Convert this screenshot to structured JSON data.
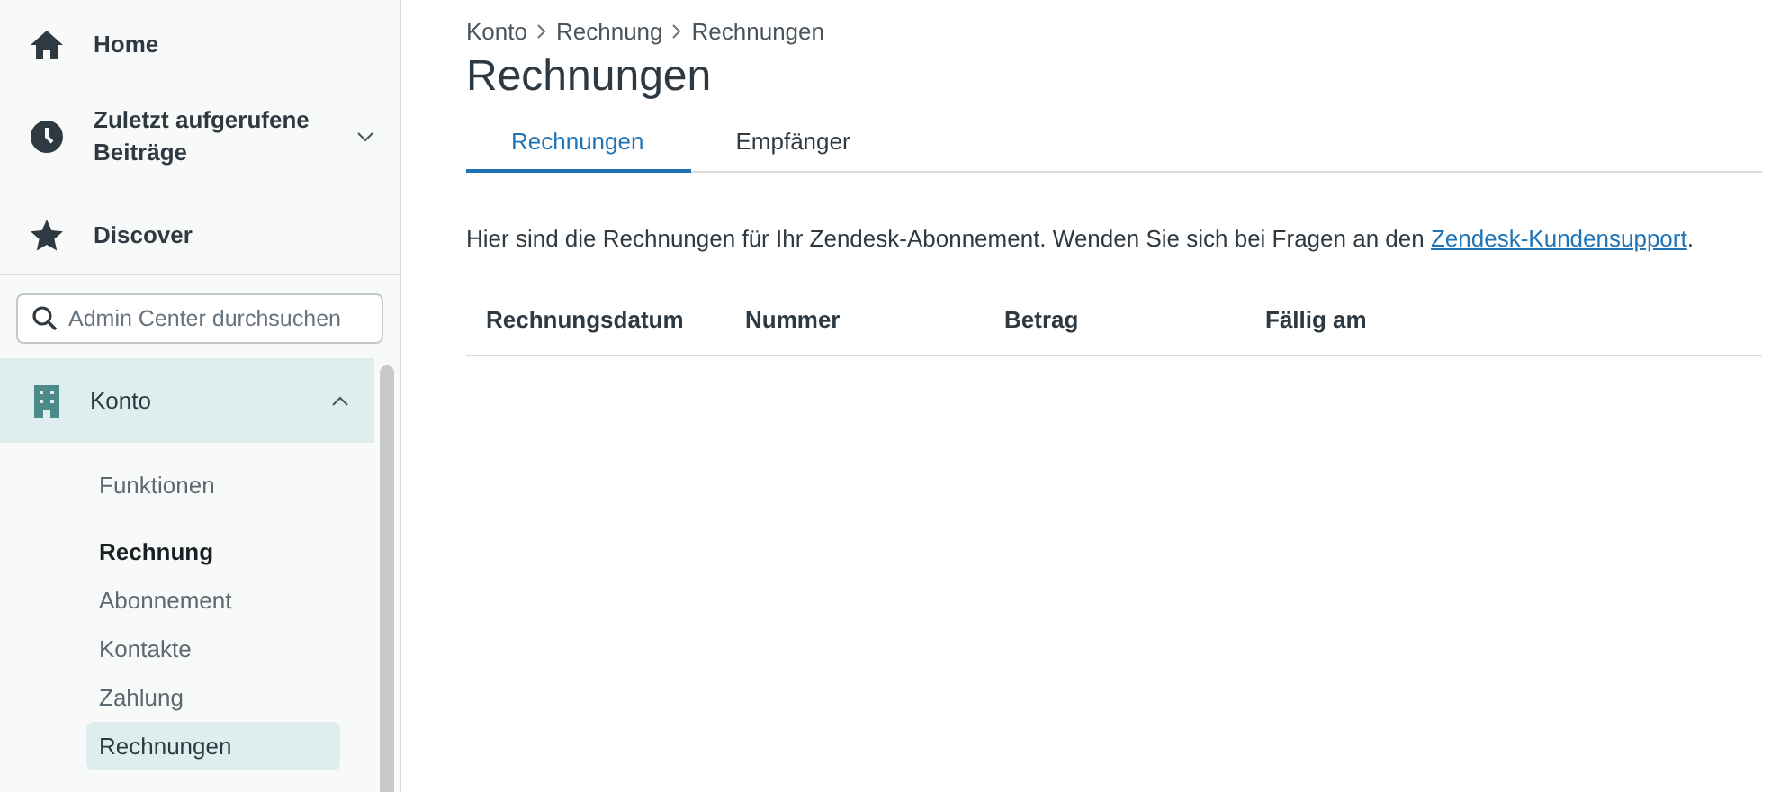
{
  "sidebar": {
    "nav": [
      {
        "label": "Home",
        "kind": "home"
      },
      {
        "label": "Zuletzt aufgerufene Beiträge",
        "kind": "clock",
        "expanded": false
      },
      {
        "label": "Discover",
        "kind": "star"
      }
    ],
    "search": {
      "placeholder": "Admin Center durchsuchen"
    },
    "section": {
      "label": "Konto",
      "expanded": true,
      "items": [
        {
          "label": "Funktionen",
          "kind": "link",
          "selected": false
        },
        {
          "label": "Rechnung",
          "kind": "heading",
          "selected": false
        },
        {
          "label": "Abonnement",
          "kind": "link",
          "selected": false
        },
        {
          "label": "Kontakte",
          "kind": "link",
          "selected": false
        },
        {
          "label": "Zahlung",
          "kind": "link",
          "selected": false
        },
        {
          "label": "Rechnungen",
          "kind": "link",
          "selected": true
        }
      ]
    }
  },
  "breadcrumb": [
    "Konto",
    "Rechnung",
    "Rechnungen"
  ],
  "title": "Rechnungen",
  "tabs": [
    {
      "label": "Rechnungen",
      "selected": true
    },
    {
      "label": "Empfänger",
      "selected": false
    }
  ],
  "description": {
    "text": "Hier sind die Rechnungen für Ihr Zendesk-Abonnement. Wenden Sie sich bei Fragen an den ",
    "link": "Zendesk-Kundensupport",
    "after": "."
  },
  "table": {
    "columns": [
      "Rechnungsdatum",
      "Nummer",
      "Betrag",
      "Fällig am"
    ]
  }
}
